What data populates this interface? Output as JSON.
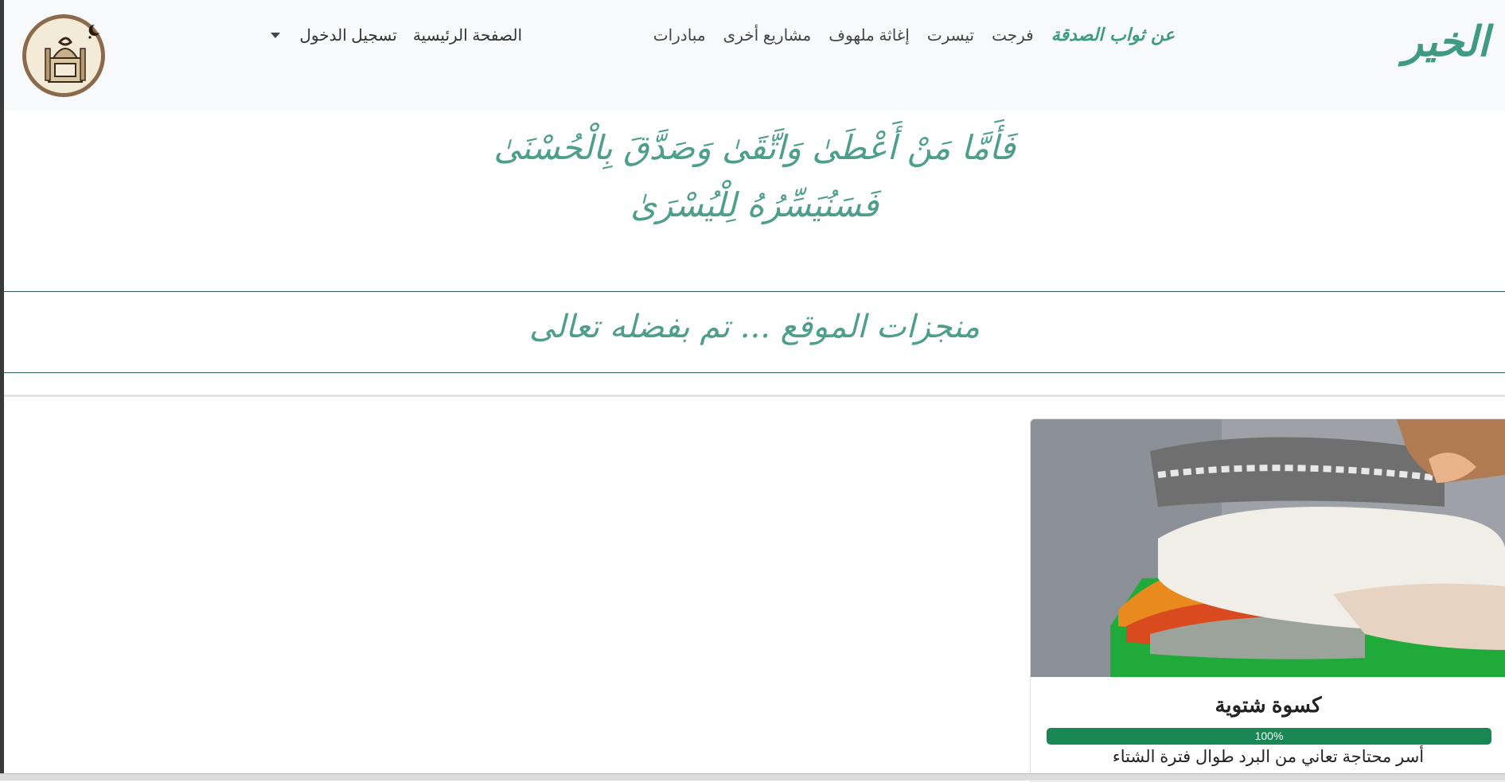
{
  "brand": {
    "name": "الخير"
  },
  "nav": {
    "primary": [
      {
        "label": "عن ثواب الصدقة",
        "active": true
      },
      {
        "label": "فرجت"
      },
      {
        "label": "تيسرت"
      },
      {
        "label": "إغاثة ملهوف"
      },
      {
        "label": "مشاريع أخرى"
      },
      {
        "label": "مبادرات"
      }
    ],
    "secondary": [
      {
        "label": "الصفحة الرئيسية"
      },
      {
        "label": "تسجيل الدخول"
      }
    ]
  },
  "verse": {
    "line1": "فَأَمَّا مَنْ أَعْطَىٰ وَاتَّقَىٰ وَصَدَّقَ بِالْحُسْنَىٰ",
    "line2": "فَسَنُيَسِّرُهُ لِلْيُسْرَىٰ"
  },
  "achievements": {
    "heading": "منجزات الموقع ... تم بفضله تعالى"
  },
  "cards": [
    {
      "title": "كسوة شتوية",
      "progress": 100,
      "progress_label": "100%",
      "description": "أسر محتاجة تعاني من البرد طوال فترة الشتاء"
    }
  ],
  "colors": {
    "accent": "#3e9a82",
    "progress": "#198754",
    "navbar": "#f8f9fa"
  }
}
